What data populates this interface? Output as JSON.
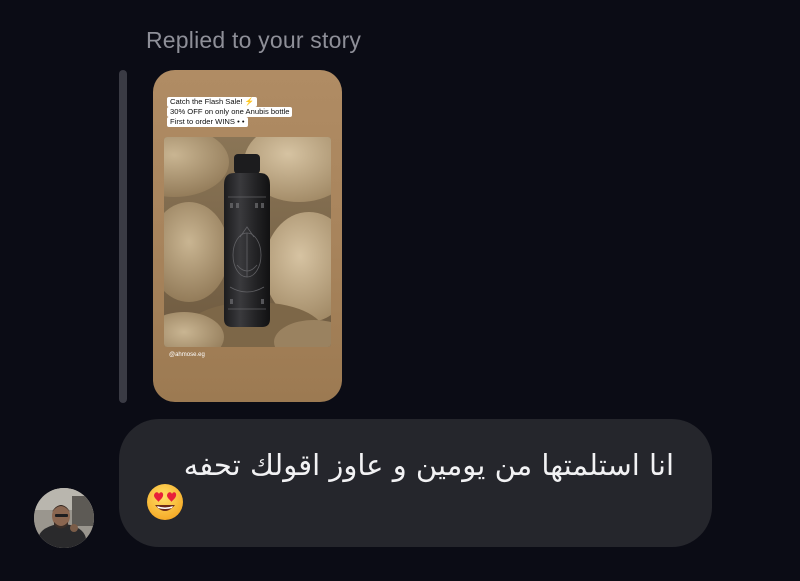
{
  "header": {
    "replied_label": "Replied to your story"
  },
  "story": {
    "caption_line1": "Catch the Flash Sale! ⚡",
    "caption_line2": "30% OFF on only one Anubis bottle",
    "caption_line3": "First to order WINS • •",
    "handle": "@ahmose.eg"
  },
  "message": {
    "text": "انا استلمتها من يومين و عاوز اقولك تحفه",
    "emoji": "heart-eyes-emoji"
  },
  "sender": {
    "avatar": "avatar-photo"
  },
  "colors": {
    "background": "#0b0c15",
    "bubble": "#25262c",
    "label": "#8e8f98",
    "reply_bar": "#3a3b44"
  }
}
